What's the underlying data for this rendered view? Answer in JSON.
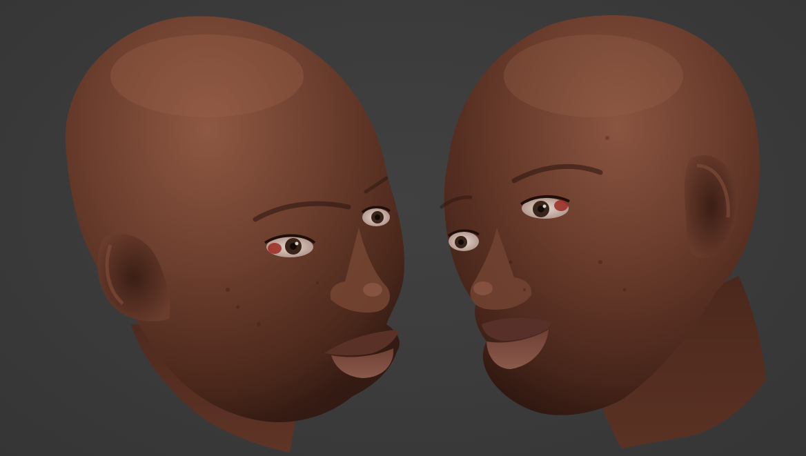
{
  "scene": {
    "background_color": "#3b3b3b",
    "skin_base_color": "#6a3d2c",
    "skin_highlight_color": "#8a5540",
    "skin_shadow_color": "#3d2016",
    "lip_color": "#7a4a3e",
    "eye_white_color": "#d9c9c2",
    "eye_inner_color": "#9b2a22",
    "iris_color": "#2c1a12"
  },
  "views": [
    {
      "name": "three-quarter-left",
      "facing": "right"
    },
    {
      "name": "three-quarter-right",
      "facing": "left"
    }
  ]
}
